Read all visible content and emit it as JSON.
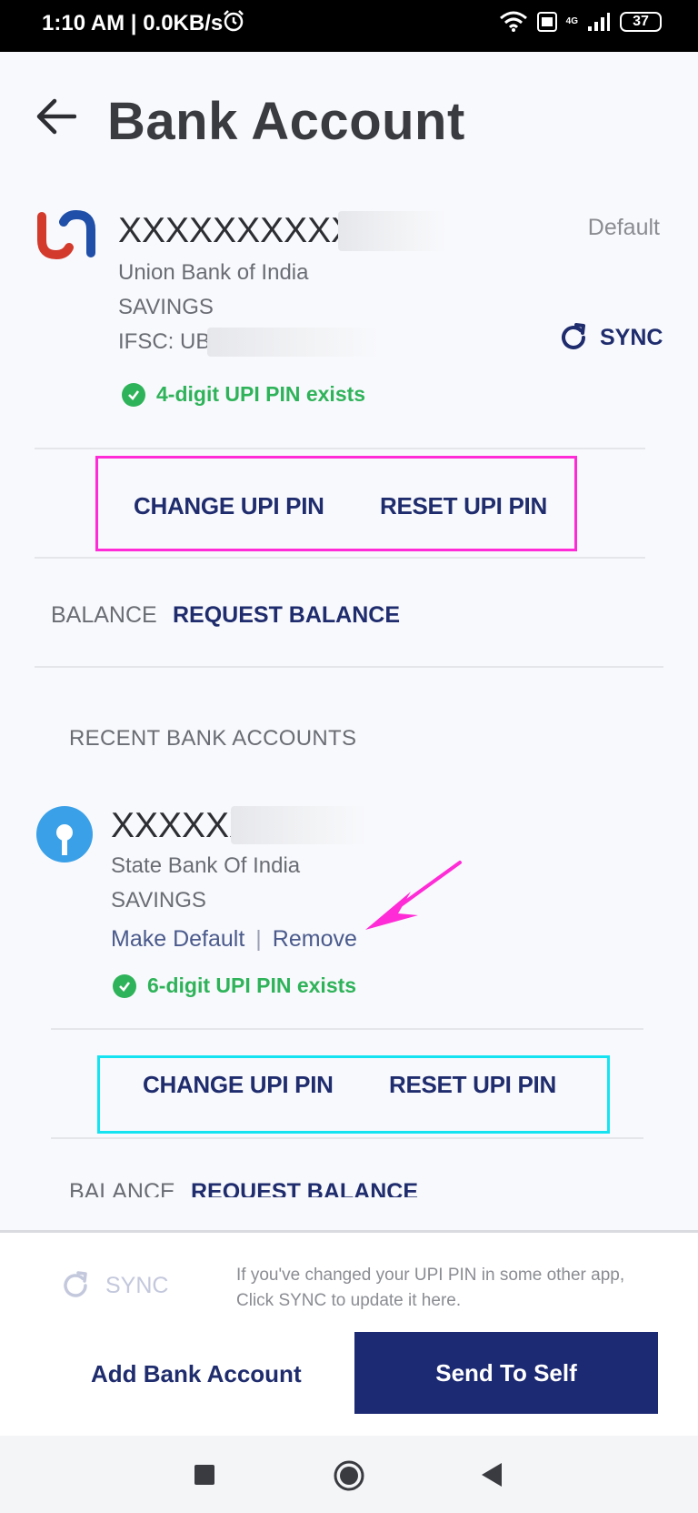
{
  "status_bar": {
    "time": "1:10 AM | 0.0KB/s",
    "battery": "37",
    "network_label": "4G"
  },
  "header": {
    "title": "Bank Account"
  },
  "primary_account": {
    "account_number": "XXXXXXXXXX",
    "bank_name": "Union Bank of India",
    "account_type": "SAVINGS",
    "ifsc": "IFSC: UB",
    "default_label": "Default",
    "sync_label": "SYNC",
    "pin_status": "4-digit UPI PIN exists",
    "change_pin": "CHANGE UPI PIN",
    "reset_pin": "RESET UPI PIN",
    "balance_label": "BALANCE",
    "request_balance": "REQUEST BALANCE"
  },
  "recent_section": {
    "title": "RECENT BANK ACCOUNTS"
  },
  "recent_account": {
    "account_number": "XXXXXX",
    "bank_name": "State Bank Of India",
    "account_type": "SAVINGS",
    "make_default": "Make Default",
    "separator": "|",
    "remove": "Remove",
    "pin_status": "6-digit UPI PIN exists",
    "change_pin": "CHANGE UPI PIN",
    "reset_pin": "RESET UPI PIN",
    "balance_label": "BALANCE",
    "request_balance": "REQUEST BALANCE"
  },
  "bottom": {
    "sync_label": "SYNC",
    "sync_help": "If you've changed your UPI PIN in some other app, Click SYNC to update it here.",
    "add_bank": "Add Bank Account",
    "send_to_self": "Send To Self"
  },
  "colors": {
    "brand_navy": "#1c2a73",
    "success_green": "#2fb35a",
    "annotation_magenta": "#ff2bd6",
    "annotation_cyan": "#16e3f2"
  }
}
